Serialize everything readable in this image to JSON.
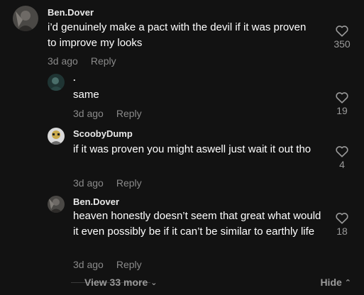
{
  "comments": [
    {
      "username": "Ben.Dover",
      "text": "i’d genuinely make a pact with the devil if it was proven to improve my looks",
      "time": "3d ago",
      "reply_label": "Reply",
      "likes": "350"
    },
    {
      "username": ".",
      "text": "same",
      "time": "3d ago",
      "reply_label": "Reply",
      "likes": "19"
    },
    {
      "username": "ScoobyDump",
      "text": "if it was proven you might aswell just wait it out tho",
      "time": "3d ago",
      "reply_label": "Reply",
      "likes": "4"
    },
    {
      "username": "Ben.Dover",
      "text": "heaven honestly doesn’t seem that great what would it even possibly be if it can’t be similar to earthly life",
      "time": "3d ago",
      "reply_label": "Reply",
      "likes": "18"
    }
  ],
  "footer": {
    "view_more": "View 33 more",
    "hide": "Hide"
  },
  "colors": {
    "background": "#121212",
    "muted": "#8a8a8a"
  }
}
